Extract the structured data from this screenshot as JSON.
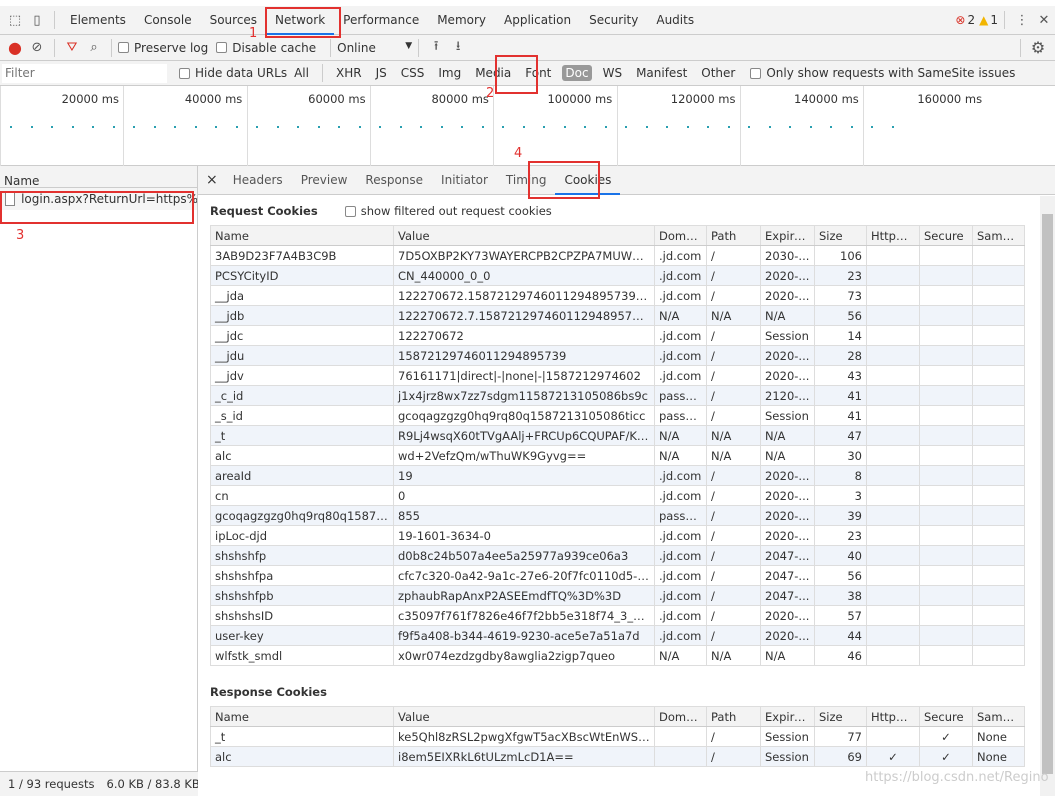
{
  "tabs": [
    "Elements",
    "Console",
    "Sources",
    "Network",
    "Performance",
    "Memory",
    "Application",
    "Security",
    "Audits"
  ],
  "active_tab": "Network",
  "errors": "2",
  "warnings": "1",
  "toolbar": {
    "preserve_log": "Preserve log",
    "disable_cache": "Disable cache",
    "throttle": "Online"
  },
  "filterbar": {
    "placeholder": "Filter",
    "hide_data_urls": "Hide data URLs",
    "types": [
      "All",
      "XHR",
      "JS",
      "CSS",
      "Img",
      "Media",
      "Font",
      "Doc",
      "WS",
      "Manifest",
      "Other"
    ],
    "active_type": "Doc",
    "samesite": "Only show requests with SameSite issues"
  },
  "timeline": [
    "20000 ms",
    "40000 ms",
    "60000 ms",
    "80000 ms",
    "100000 ms",
    "120000 ms",
    "140000 ms",
    "160000 ms"
  ],
  "annotations": [
    "1",
    "2",
    "3",
    "4"
  ],
  "requests": {
    "header": "Name",
    "items": [
      "login.aspx?ReturnUrl=https%3..."
    ]
  },
  "status": {
    "requests": "1 / 93 requests",
    "transferred": "6.0 KB / 83.8 KB"
  },
  "detail": {
    "close": "×",
    "tabs": [
      "Headers",
      "Preview",
      "Response",
      "Initiator",
      "Timing",
      "Cookies"
    ],
    "active": "Cookies"
  },
  "cookies": {
    "request_title": "Request Cookies",
    "show_filtered": "show filtered out request cookies",
    "response_title": "Response Cookies",
    "columns": [
      "Name",
      "Value",
      "Domain",
      "Path",
      "Expire...",
      "Size",
      "HttpO...",
      "Secure",
      "SameS..."
    ],
    "request": [
      [
        "3AB9D23F7A4B3C9B",
        "7D5OXBP2KY73WAYERCPB2CPZPA7MUWDTE...",
        ".jd.com",
        "/",
        "2030-...",
        "106",
        "",
        "",
        ""
      ],
      [
        "PCSYCityID",
        "CN_440000_0_0",
        ".jd.com",
        "/",
        "2020-...",
        "23",
        "",
        "",
        ""
      ],
      [
        "__jda",
        "122270672.15872129746011294895739.1587...",
        ".jd.com",
        "/",
        "2020-...",
        "73",
        "",
        "",
        ""
      ],
      [
        "__jdb",
        "122270672.7.15872129746011294895739|1.1...",
        "N/A",
        "N/A",
        "N/A",
        "56",
        "",
        "",
        ""
      ],
      [
        "__jdc",
        "122270672",
        ".jd.com",
        "/",
        "Session",
        "14",
        "",
        "",
        ""
      ],
      [
        "__jdu",
        "15872129746011294895739",
        ".jd.com",
        "/",
        "2020-...",
        "28",
        "",
        "",
        ""
      ],
      [
        "__jdv",
        "76161171|direct|-|none|-|1587212974602",
        ".jd.com",
        "/",
        "2020-...",
        "43",
        "",
        "",
        ""
      ],
      [
        "_c_id",
        "j1x4jrz8wx7zz7sdgm11587213105086bs9c",
        "passp...",
        "/",
        "2120-...",
        "41",
        "",
        "",
        ""
      ],
      [
        "_s_id",
        "gcoqagzgzg0hq9rq80q1587213105086ticc",
        "passp...",
        "/",
        "Session",
        "41",
        "",
        "",
        ""
      ],
      [
        "_t",
        "R9Lj4wsqX60tTVgAAlj+FRCUp6CQUPAF/KZr5...",
        "N/A",
        "N/A",
        "N/A",
        "47",
        "",
        "",
        ""
      ],
      [
        "alc",
        "wd+2VefzQm/wThuWK9Gyvg==",
        "N/A",
        "N/A",
        "N/A",
        "30",
        "",
        "",
        ""
      ],
      [
        "areaId",
        "19",
        ".jd.com",
        "/",
        "2020-...",
        "8",
        "",
        "",
        ""
      ],
      [
        "cn",
        "0",
        ".jd.com",
        "/",
        "2020-...",
        "3",
        "",
        "",
        ""
      ],
      [
        "gcoqagzgzg0hq9rq80q158721...",
        "855",
        "passp...",
        "/",
        "2020-...",
        "39",
        "",
        "",
        ""
      ],
      [
        "ipLoc-djd",
        "19-1601-3634-0",
        ".jd.com",
        "/",
        "2020-...",
        "23",
        "",
        "",
        ""
      ],
      [
        "shshshfp",
        "d0b8c24b507a4ee5a25977a939ce06a3",
        ".jd.com",
        "/",
        "2047-...",
        "40",
        "",
        "",
        ""
      ],
      [
        "shshshfpa",
        "cfc7c320-0a42-9a1c-27e6-20f7fc0110d5-158...",
        ".jd.com",
        "/",
        "2047-...",
        "56",
        "",
        "",
        ""
      ],
      [
        "shshshfpb",
        "zphaubRapAnxP2ASEEmdfTQ%3D%3D",
        ".jd.com",
        "/",
        "2047-...",
        "38",
        "",
        "",
        ""
      ],
      [
        "shshshsID",
        "c35097f761f7826e46f7f2bb5e318f74_3_1587...",
        ".jd.com",
        "/",
        "2020-...",
        "57",
        "",
        "",
        ""
      ],
      [
        "user-key",
        "f9f5a408-b344-4619-9230-ace5e7a51a7d",
        ".jd.com",
        "/",
        "2020-...",
        "44",
        "",
        "",
        ""
      ],
      [
        "wlfstk_smdl",
        "x0wr074ezdzgdby8awglia2zigp7queo",
        "N/A",
        "N/A",
        "N/A",
        "46",
        "",
        "",
        ""
      ]
    ],
    "response": [
      [
        "_t",
        "ke5Qhl8zRSL2pwgXfgwT5acXBscWtEnWSXEp...",
        "",
        "/",
        "Session",
        "77",
        "",
        "✓",
        "None"
      ],
      [
        "alc",
        "i8em5EIXRkL6tULzmLcD1A==",
        "",
        "/",
        "Session",
        "69",
        "✓",
        "✓",
        "None"
      ]
    ]
  },
  "watermark": "https://blog.csdn.net/Regino"
}
